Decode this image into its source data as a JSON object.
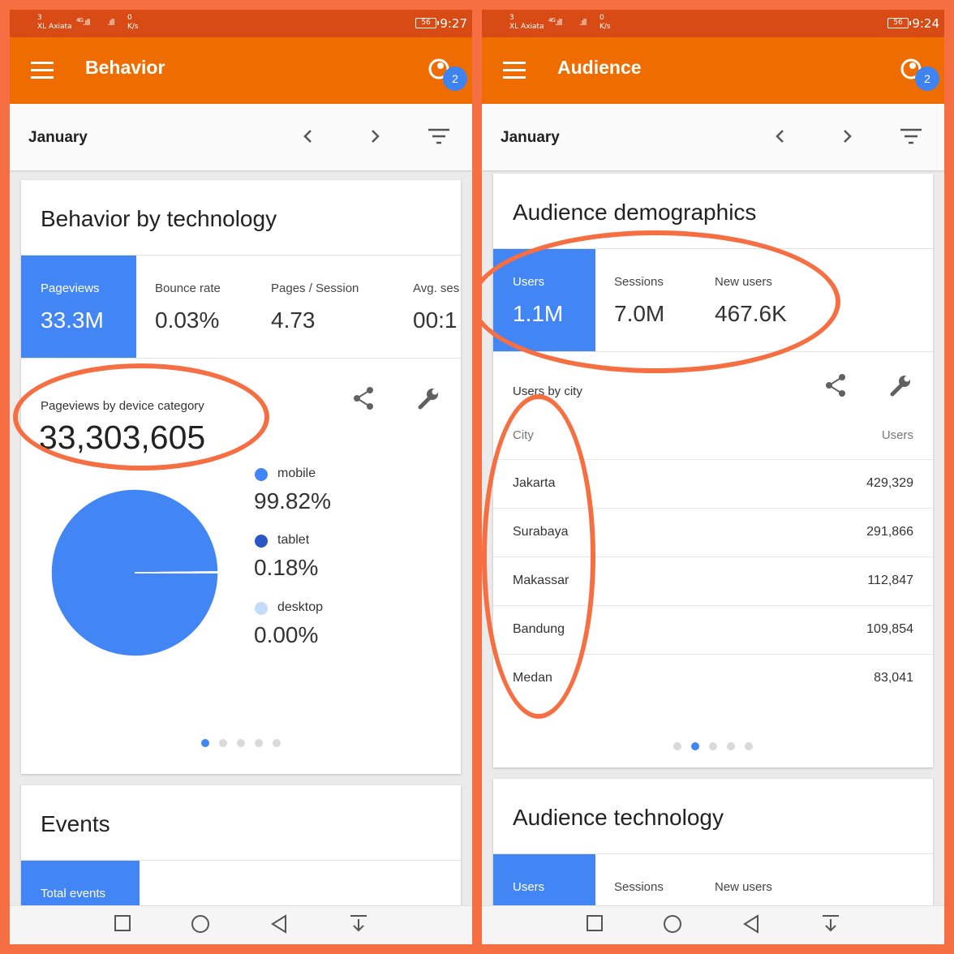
{
  "left": {
    "status": {
      "carrier_top": "3",
      "carrier": "XL Axiata",
      "net": "4G",
      "speed_top": "0",
      "speed_unit": "K/s",
      "battery": "56",
      "time": "9:27"
    },
    "appbar": {
      "title": "Behavior",
      "badge": "2"
    },
    "datebar": {
      "date": "January"
    },
    "card1": {
      "title": "Behavior by technology",
      "metrics": [
        {
          "label": "Pageviews",
          "value": "33.3M"
        },
        {
          "label": "Bounce rate",
          "value": "0.03%"
        },
        {
          "label": "Pages / Session",
          "value": "4.73"
        },
        {
          "label": "Avg. ses",
          "value": "00:1"
        }
      ],
      "subtitle": "Pageviews by device category",
      "total": "33,303,605",
      "legend": [
        {
          "label": "mobile",
          "value": "99.82%",
          "color": "#4285f4"
        },
        {
          "label": "tablet",
          "value": "0.18%",
          "color": "#2a56c6"
        },
        {
          "label": "desktop",
          "value": "0.00%",
          "color": "#c6dafc"
        }
      ]
    },
    "card2": {
      "title": "Events",
      "metric_label": "Total events"
    },
    "colors": {
      "accent": "#4285f4",
      "appbar": "#ef6c00",
      "status": "#d94b14",
      "highlight": "#f56f42"
    }
  },
  "right": {
    "status": {
      "carrier_top": "3",
      "carrier": "XL Axiata",
      "net": "4G",
      "speed_top": "0",
      "speed_unit": "K/s",
      "battery": "56",
      "time": "9:24"
    },
    "appbar": {
      "title": "Audience",
      "badge": "2"
    },
    "datebar": {
      "date": "January"
    },
    "card1": {
      "title": "Audience demographics",
      "metrics": [
        {
          "label": "Users",
          "value": "1.1M"
        },
        {
          "label": "Sessions",
          "value": "7.0M"
        },
        {
          "label": "New users",
          "value": "467.6K"
        }
      ],
      "subtitle": "Users by city",
      "table": {
        "headers": [
          "City",
          "Users"
        ],
        "rows": [
          [
            "Jakarta",
            "429,329"
          ],
          [
            "Surabaya",
            "291,866"
          ],
          [
            "Makassar",
            "112,847"
          ],
          [
            "Bandung",
            "109,854"
          ],
          [
            "Medan",
            "83,041"
          ]
        ]
      }
    },
    "card2": {
      "title": "Audience technology",
      "metrics": [
        {
          "label": "Users"
        },
        {
          "label": "Sessions"
        },
        {
          "label": "New users"
        }
      ]
    }
  },
  "chart_data": {
    "type": "pie",
    "categories": [
      "mobile",
      "tablet",
      "desktop"
    ],
    "values": [
      99.82,
      0.18,
      0.0
    ]
  }
}
